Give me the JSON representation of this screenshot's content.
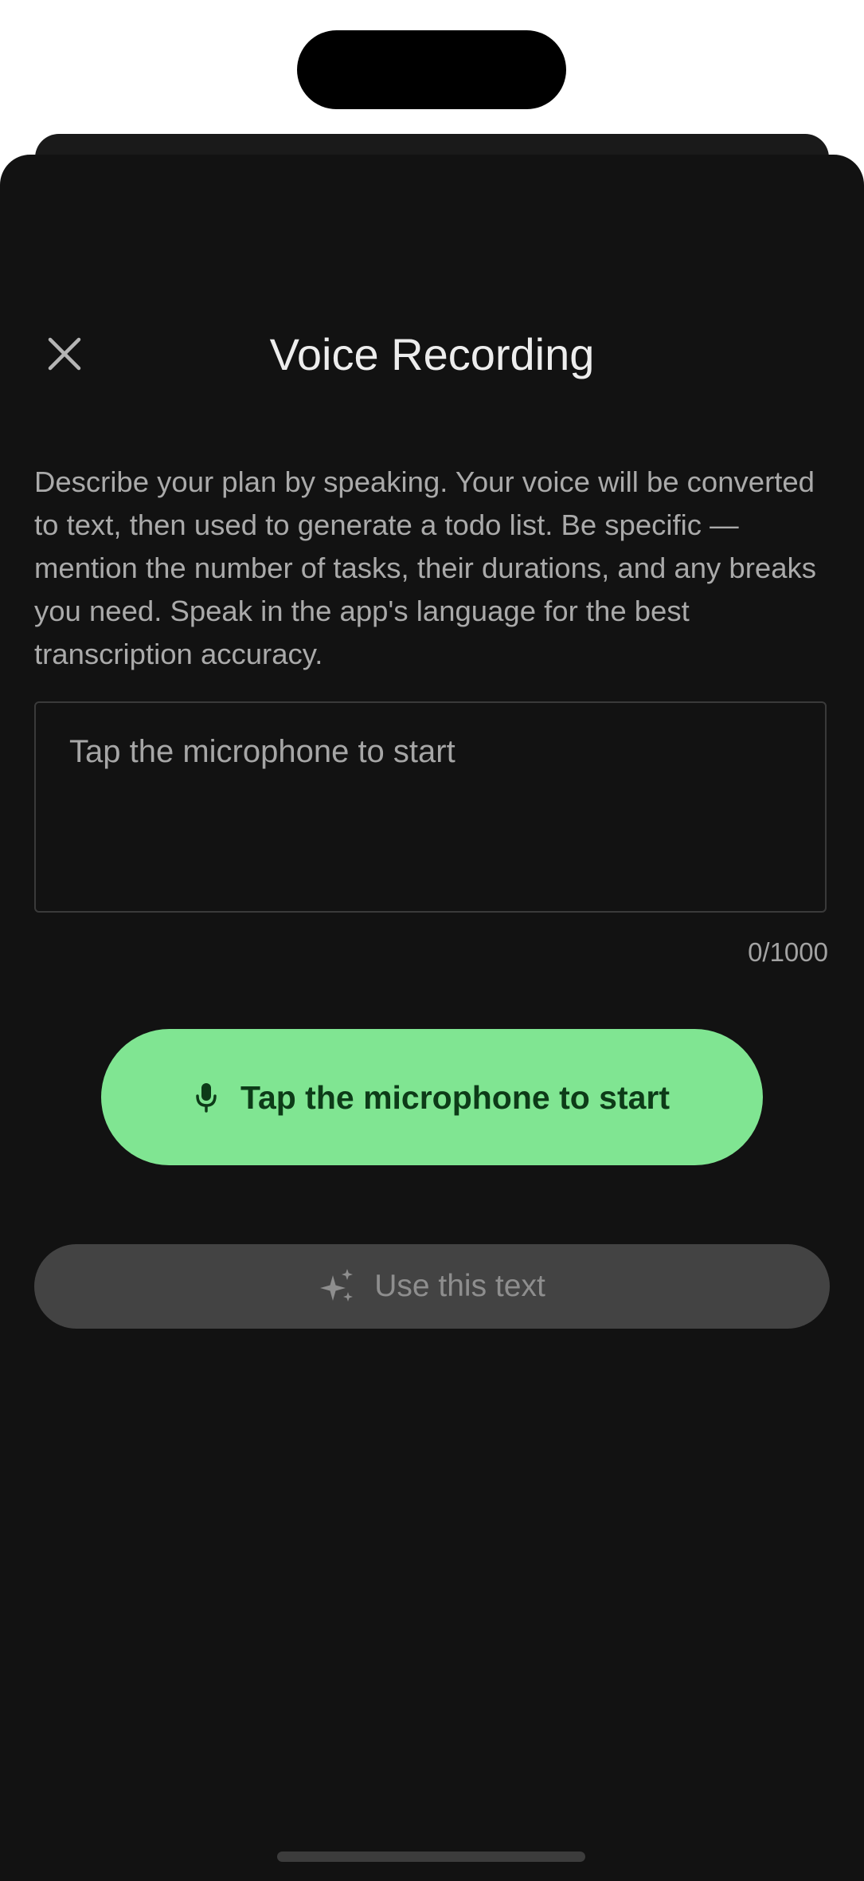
{
  "header": {
    "title": "Voice Recording",
    "close_icon": "close-icon"
  },
  "description": "Describe your plan by speaking. Your voice will be converted to text, then used to generate a todo list. Be specific — mention the number of tasks, their durations, and any breaks you need. Speak in the app's language for the best transcription accuracy.",
  "transcript": {
    "value": "",
    "placeholder": "Tap the microphone to start",
    "counter": "0/1000"
  },
  "mic_button": {
    "label": "Tap the microphone to start",
    "icon": "microphone-icon"
  },
  "use_button": {
    "label": "Use this text",
    "icon": "sparkles-icon"
  },
  "colors": {
    "sheet_background": "#121212",
    "accent_green": "#80e592",
    "accent_text": "#0d3b18",
    "disabled_button": "#434343"
  }
}
